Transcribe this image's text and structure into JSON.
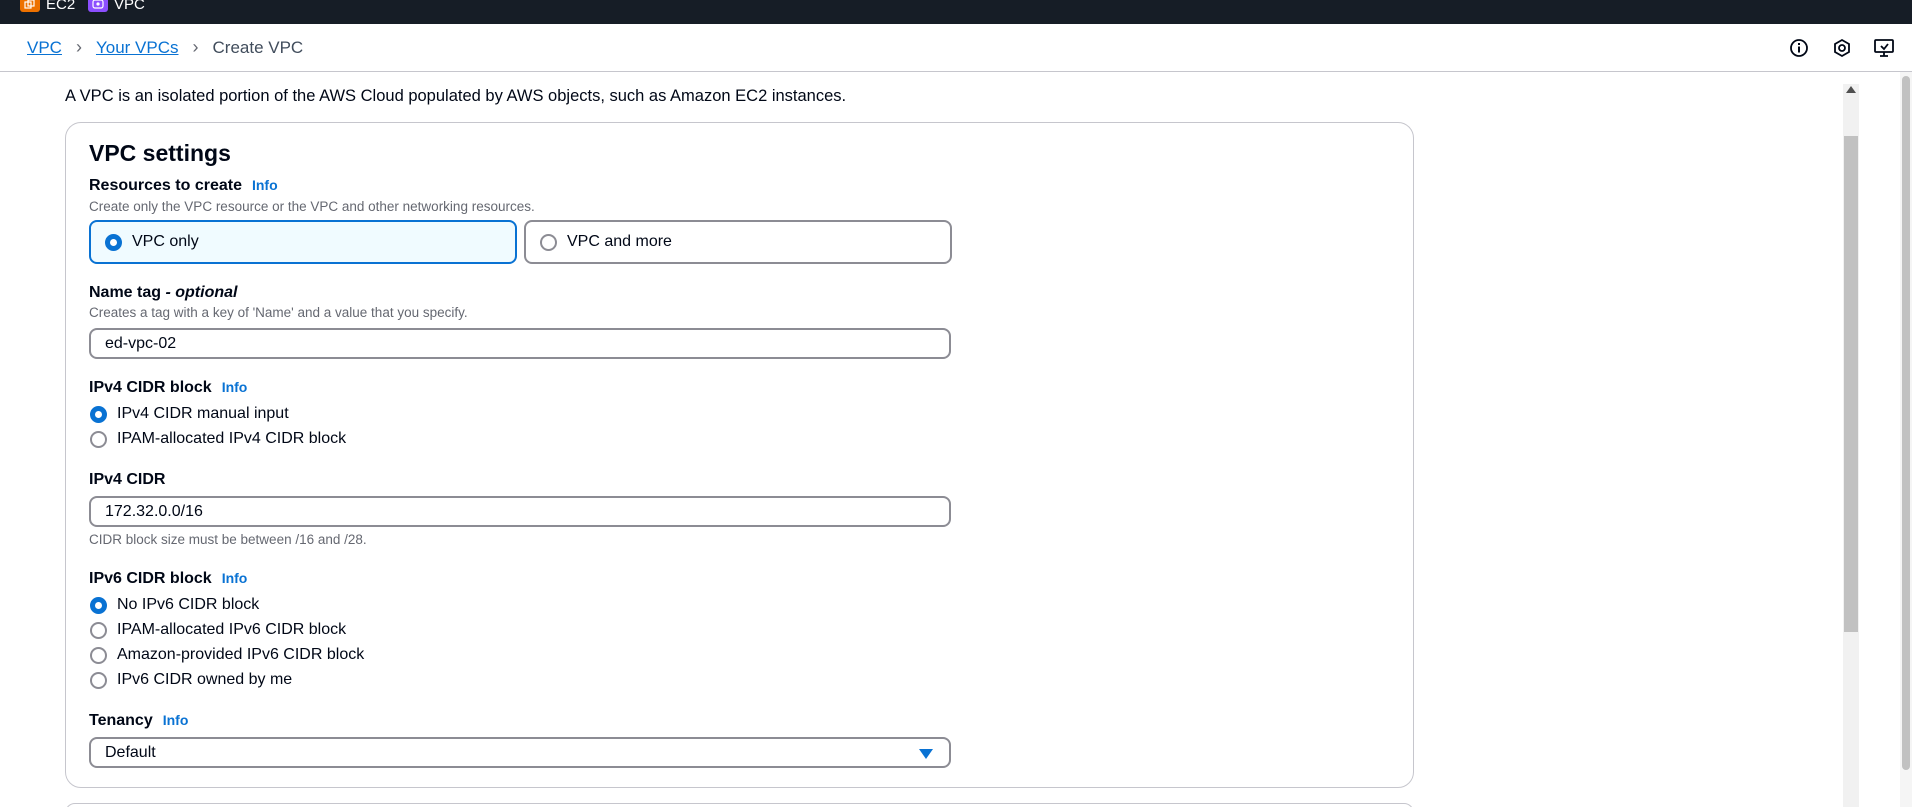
{
  "favorites": [
    {
      "label": "EC2",
      "icon": "ec2-service-icon",
      "color": "#ed7100"
    },
    {
      "label": "VPC",
      "icon": "vpc-service-icon",
      "color": "#8c4fff"
    }
  ],
  "breadcrumb": {
    "items": [
      "VPC",
      "Your VPCs"
    ],
    "current": "Create VPC"
  },
  "intro": "A VPC is an isolated portion of the AWS Cloud populated by AWS objects, such as Amazon EC2 instances.",
  "card": {
    "title": "VPC settings",
    "resources": {
      "label": "Resources to create",
      "info": "Info",
      "description": "Create only the VPC resource or the VPC and other networking resources.",
      "options": [
        "VPC only",
        "VPC and more"
      ],
      "selected": "VPC only"
    },
    "name_tag": {
      "label": "Name tag",
      "optional": "- optional",
      "description": "Creates a tag with a key of 'Name' and a value that you specify.",
      "value": "ed-vpc-02"
    },
    "ipv4_block": {
      "label": "IPv4 CIDR block",
      "info": "Info",
      "options": [
        "IPv4 CIDR manual input",
        "IPAM-allocated IPv4 CIDR block"
      ],
      "selected": "IPv4 CIDR manual input"
    },
    "ipv4_cidr": {
      "label": "IPv4 CIDR",
      "value": "172.32.0.0/16",
      "hint": "CIDR block size must be between /16 and /28."
    },
    "ipv6_block": {
      "label": "IPv6 CIDR block",
      "info": "Info",
      "options": [
        "No IPv6 CIDR block",
        "IPAM-allocated IPv6 CIDR block",
        "Amazon-provided IPv6 CIDR block",
        "IPv6 CIDR owned by me"
      ],
      "selected": "No IPv6 CIDR block"
    },
    "tenancy": {
      "label": "Tenancy",
      "info": "Info",
      "value": "Default"
    }
  },
  "colors": {
    "accent": "#0972d3",
    "topbar": "#161d26",
    "border": "#8c8c94",
    "selected_tile_bg": "#f0fbff"
  }
}
